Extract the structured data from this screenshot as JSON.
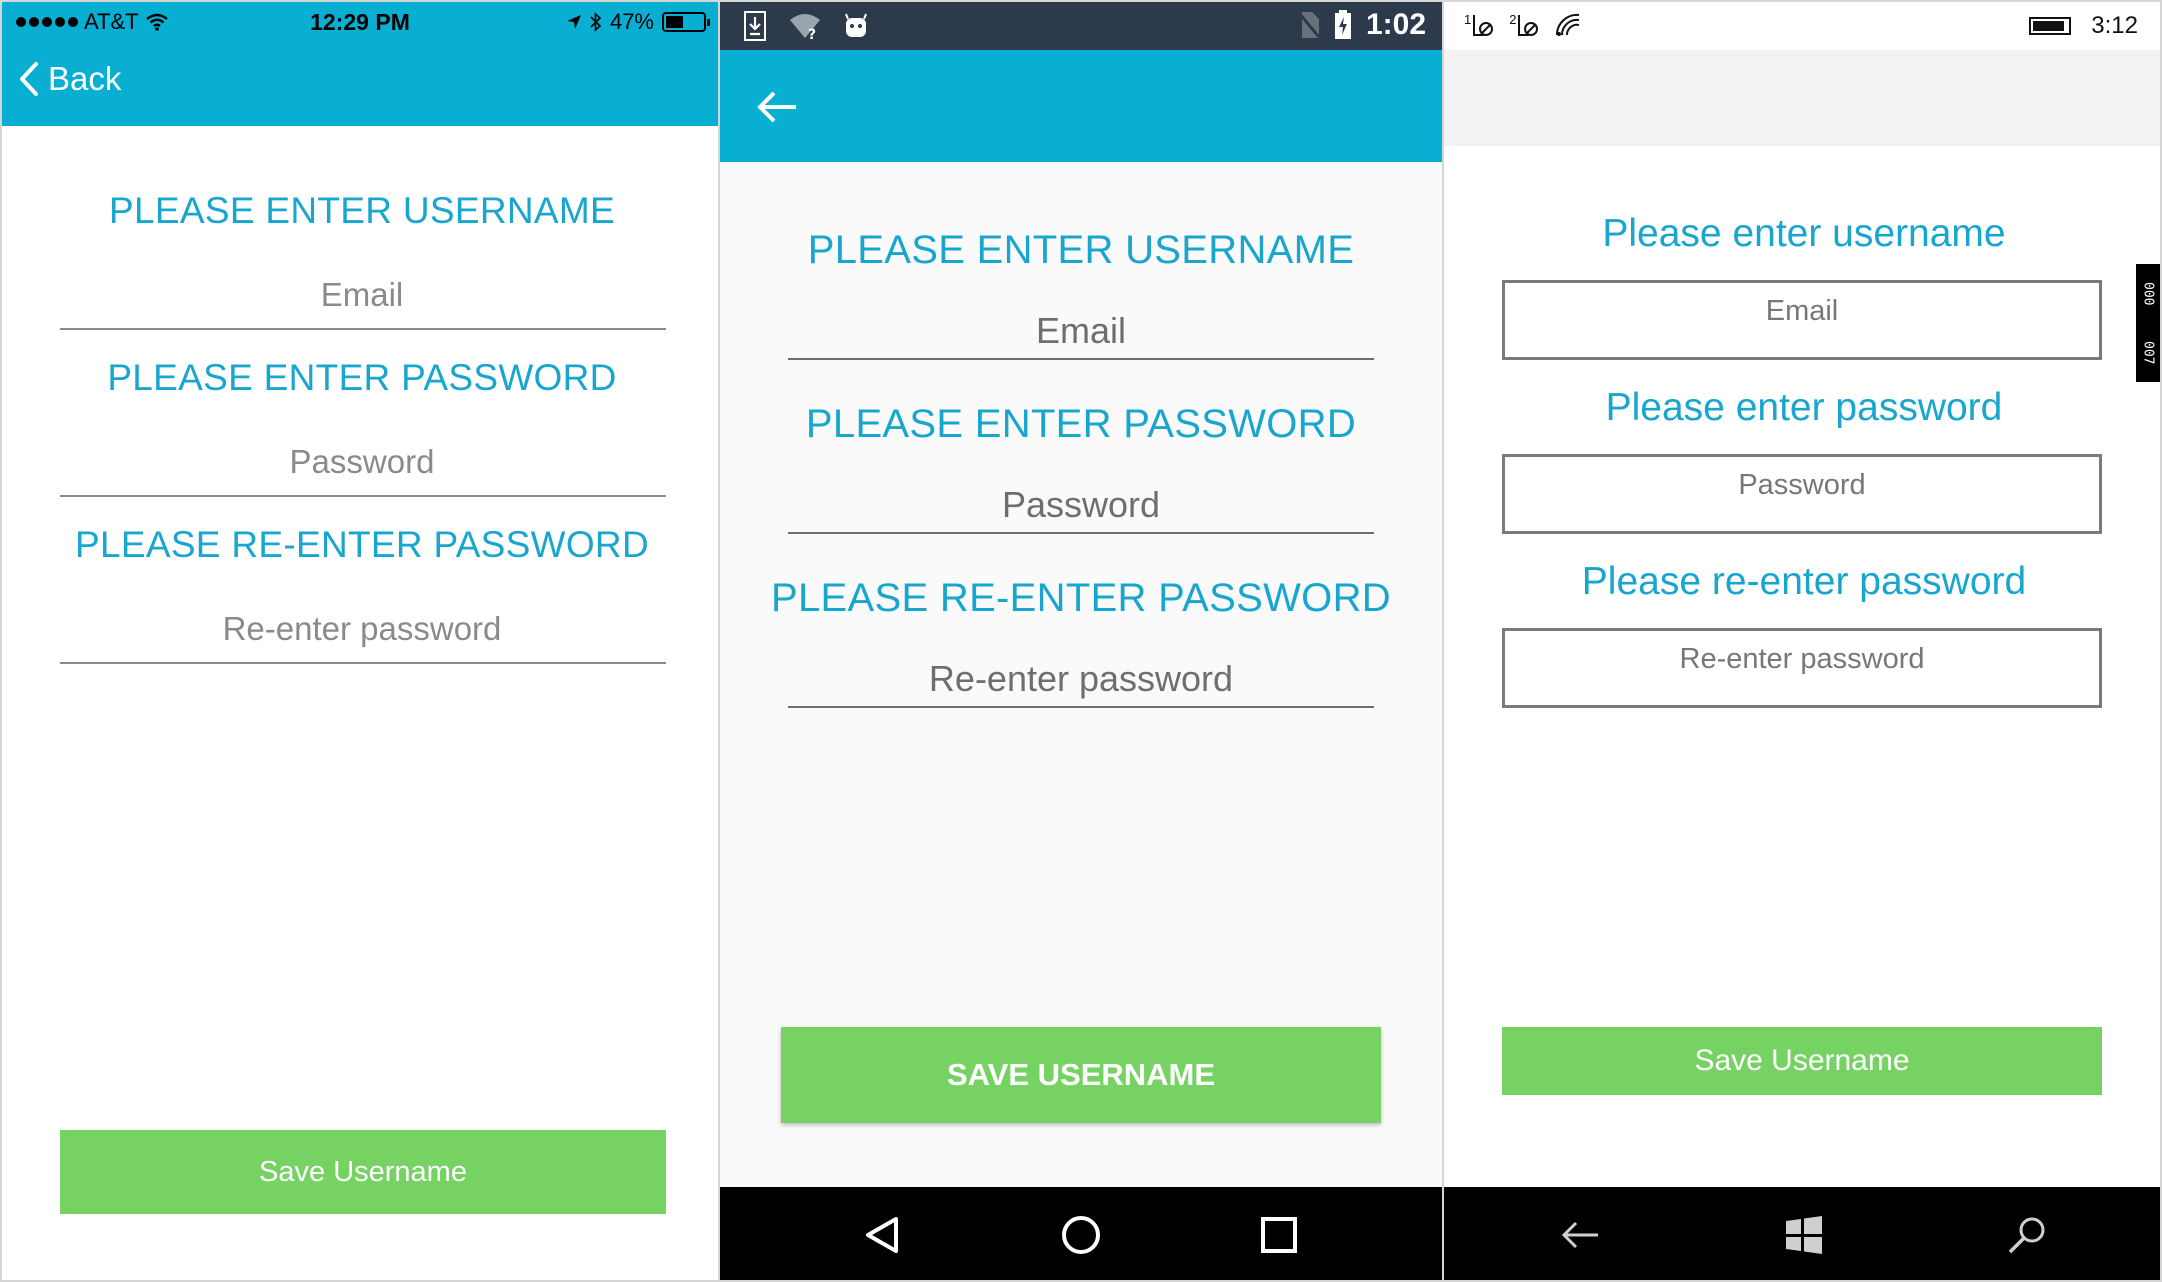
{
  "ios": {
    "status": {
      "carrier": "AT&T",
      "time": "12:29 PM",
      "battery_text": "47%",
      "battery_level": 0.47
    },
    "back_label": "Back",
    "username_title": "PLEASE ENTER USERNAME",
    "email_placeholder": "Email",
    "password_title": "PLEASE ENTER PASSWORD",
    "password_placeholder": "Password",
    "reenter_title": "PLEASE RE-ENTER PASSWORD",
    "reenter_placeholder": "Re-enter password",
    "save_button": "Save Username"
  },
  "android": {
    "status": {
      "time": "1:02"
    },
    "username_title": "PLEASE ENTER USERNAME",
    "email_placeholder": "Email",
    "password_title": "PLEASE ENTER PASSWORD",
    "password_placeholder": "Password",
    "reenter_title": "PLEASE RE-ENTER PASSWORD",
    "reenter_placeholder": "Re-enter password",
    "save_button": "SAVE USERNAME"
  },
  "windows": {
    "status": {
      "time": "3:12",
      "sim1": "1",
      "sim2": "2",
      "battery_level": 0.9
    },
    "username_title": "Please enter username",
    "email_placeholder": "Email",
    "password_title": "Please enter password",
    "password_placeholder": "Password",
    "reenter_title": "Please re-enter password",
    "reenter_placeholder": "Re-enter password",
    "save_button": "Save Username",
    "frame_counter": [
      "000",
      "007"
    ]
  },
  "colors": {
    "header": "#09aed3",
    "title": "#18a6cf",
    "button": "#77d264"
  }
}
